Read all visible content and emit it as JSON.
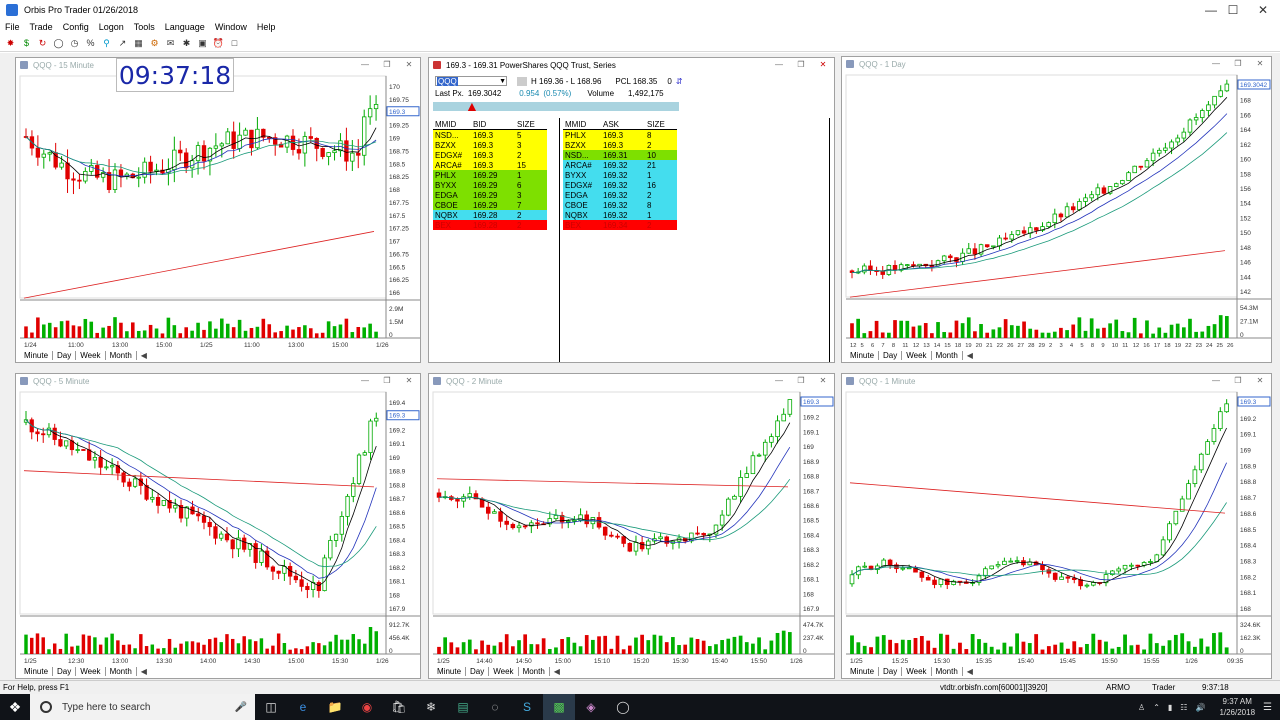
{
  "window": {
    "title": "Orbis Pro Trader  01/26/2018"
  },
  "menu": [
    "File",
    "Trade",
    "Config",
    "Logon",
    "Tools",
    "Language",
    "Window",
    "Help"
  ],
  "clock": "09:37:18",
  "tabs": [
    "Minute",
    "Day",
    "Week",
    "Month"
  ],
  "panes": [
    {
      "title": "QQQ - 15 Minute",
      "price_labels": [
        "170",
        "169.75",
        "169.5",
        "169.25",
        "169",
        "168.75",
        "168.5",
        "168.25",
        "168",
        "167.75",
        "167.5",
        "167.25",
        "167",
        "166.75",
        "166.5",
        "166.25",
        "166"
      ],
      "current": "169.3",
      "vol_labels": [
        "2.9M",
        "1.5M",
        "0"
      ],
      "time_labels": [
        "1/24",
        "11:00",
        "13:00",
        "15:00",
        "1/25",
        "11:00",
        "13:00",
        "15:00",
        "1/26"
      ]
    },
    {
      "title": "QQQ - 1 Day",
      "price_labels": [
        "170",
        "168",
        "166",
        "164",
        "162",
        "160",
        "158",
        "156",
        "154",
        "152",
        "150",
        "148",
        "146",
        "144",
        "142"
      ],
      "current": "169.3042",
      "vol_labels": [
        "54.3M",
        "27.1M",
        "0"
      ],
      "time_labels": [
        "12",
        "5",
        "6",
        "7",
        "8",
        "11",
        "12",
        "13",
        "14",
        "15",
        "18",
        "19",
        "20",
        "21",
        "22",
        "26",
        "27",
        "28",
        "29",
        "2",
        "3",
        "4",
        "5",
        "8",
        "9",
        "10",
        "11",
        "12",
        "16",
        "17",
        "18",
        "19",
        "22",
        "23",
        "24",
        "25",
        "26"
      ]
    },
    {
      "title": "QQQ - 5 Minute",
      "price_labels": [
        "169.4",
        "169.3",
        "169.2",
        "169.1",
        "169",
        "168.9",
        "168.8",
        "168.7",
        "168.6",
        "168.5",
        "168.4",
        "168.3",
        "168.2",
        "168.1",
        "168",
        "167.9"
      ],
      "current": "169.3",
      "vol_labels": [
        "912.7K",
        "456.4K",
        "0"
      ],
      "time_labels": [
        "1/25",
        "12:30",
        "13:00",
        "13:30",
        "14:00",
        "14:30",
        "15:00",
        "15:30",
        "1/26"
      ]
    },
    {
      "title": "QQQ - 2 Minute",
      "price_labels": [
        "169.3",
        "169.2",
        "169.1",
        "169",
        "168.9",
        "168.8",
        "168.7",
        "168.6",
        "168.5",
        "168.4",
        "168.3",
        "168.2",
        "168.1",
        "168",
        "167.9"
      ],
      "current": "169.3",
      "vol_labels": [
        "474.7K",
        "237.4K",
        "0"
      ],
      "time_labels": [
        "1/25",
        "14:40",
        "14:50",
        "15:00",
        "15:10",
        "15:20",
        "15:30",
        "15:40",
        "15:50",
        "1/26"
      ]
    },
    {
      "title": "QQQ - 1 Minute",
      "price_labels": [
        "169.3",
        "169.2",
        "169.1",
        "169",
        "168.9",
        "168.8",
        "168.7",
        "168.6",
        "168.5",
        "168.4",
        "168.3",
        "168.2",
        "168.1",
        "168"
      ],
      "current": "169.3",
      "vol_labels": [
        "324.6K",
        "162.3K",
        "0"
      ],
      "time_labels": [
        "1/25",
        "15:25",
        "15:30",
        "15:35",
        "15:40",
        "15:45",
        "15:50",
        "15:55",
        "1/26",
        "09:35"
      ]
    }
  ],
  "quote": {
    "title": "169.3 - 169.31  PowerShares QQQ Trust, Series",
    "symbol": "QQQ",
    "high_low": "H 169.36 - L 168.96",
    "pcl": "PCL 168.35",
    "zero": "0",
    "last_label": "Last Px.",
    "last": "169.3042",
    "change": "0.954",
    "change_pct": "(0.57%)",
    "volume_label": "Volume",
    "volume": "1,492,175",
    "bid_headers": [
      "MMID",
      "BID",
      "SIZE"
    ],
    "ask_headers": [
      "MMID",
      "ASK",
      "SIZE"
    ],
    "bids": [
      [
        "NSD...",
        "169.3",
        "5",
        "#ffff00"
      ],
      [
        "BZXX",
        "169.3",
        "3",
        "#ffff00"
      ],
      [
        "EDGX#",
        "169.3",
        "2",
        "#ffff00"
      ],
      [
        "ARCA#",
        "169.3",
        "15",
        "#ffff00"
      ],
      [
        "PHLX",
        "169.29",
        "1",
        "#7ee000"
      ],
      [
        "BYXX",
        "169.29",
        "6",
        "#7ee000"
      ],
      [
        "EDGA",
        "169.29",
        "3",
        "#7ee000"
      ],
      [
        "CBOE",
        "169.29",
        "7",
        "#7ee000"
      ],
      [
        "NQBX",
        "169.28",
        "2",
        "#44ddee"
      ],
      [
        "BEX",
        "169.28",
        "2",
        "#ff0000"
      ]
    ],
    "asks": [
      [
        "PHLX",
        "169.3",
        "8",
        "#ffff00"
      ],
      [
        "BZXX",
        "169.3",
        "2",
        "#ffff00"
      ],
      [
        "NSD...",
        "169.31",
        "10",
        "#7ee000"
      ],
      [
        "ARCA#",
        "169.32",
        "21",
        "#44ddee"
      ],
      [
        "BYXX",
        "169.32",
        "1",
        "#44ddee"
      ],
      [
        "EDGX#",
        "169.32",
        "16",
        "#44ddee"
      ],
      [
        "EDGA",
        "169.32",
        "2",
        "#44ddee"
      ],
      [
        "CBOE",
        "169.32",
        "8",
        "#44ddee"
      ],
      [
        "NQBX",
        "169.32",
        "1",
        "#44ddee"
      ],
      [
        "BEX",
        "169.34",
        "2",
        "#ff0000"
      ]
    ]
  },
  "status": {
    "help": "For Help, press F1",
    "server": "vtdtr.orbisfn.com[60001][3920]",
    "firm": "ARMO",
    "role": "Trader",
    "time": "9:37:18"
  },
  "taskbar": {
    "search_placeholder": "Type here to search",
    "time": "9:37 AM",
    "date": "1/26/2018"
  }
}
